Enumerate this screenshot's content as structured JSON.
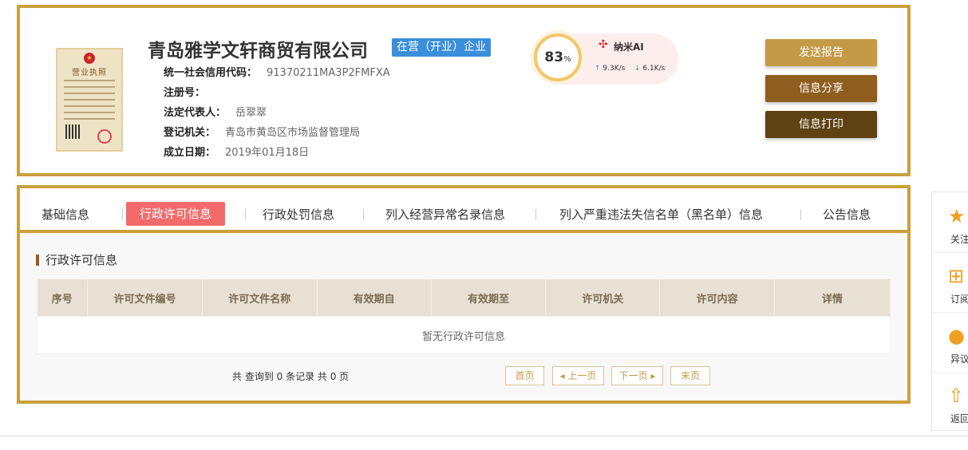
{
  "company": {
    "name": "青岛雅学文轩商贸有限公司",
    "status": "在营（开业）企业",
    "license_thumb": {
      "title": "营业执照",
      "emblem": "★"
    }
  },
  "info": [
    {
      "key": "统一社会信用代码：",
      "value": "91370211MA3P2FMFXA"
    },
    {
      "key": "注册号：",
      "value": ""
    },
    {
      "key": "法定代表人：",
      "value": "岳翠翠"
    },
    {
      "key": "登记机关：",
      "value": "青岛市黄岛区市场监督管理局"
    },
    {
      "key": "成立日期：",
      "value": "2019年01月18日"
    }
  ],
  "score_widget": {
    "score": "83",
    "unit": "%",
    "ai_label": "纳米AI",
    "upload_speed": "9.3K/s",
    "download_speed": "6.1K/s"
  },
  "actions": {
    "report": "发送报告",
    "share": "信息分享",
    "print": "信息打印"
  },
  "tabs": [
    {
      "label": "基础信息"
    },
    {
      "label": "行政许可信息"
    },
    {
      "label": "行政处罚信息"
    },
    {
      "label": "列入经营异常名录信息"
    },
    {
      "label": "列入严重违法失信名单（黑名单）信息"
    },
    {
      "label": "公告信息"
    }
  ],
  "section": {
    "title": "行政许可信息",
    "columns": [
      "序号",
      "许可文件编号",
      "许可文件名称",
      "有效期自",
      "有效期至",
      "许可机关",
      "许可内容",
      "详情"
    ],
    "empty_text": "暂无行政许可信息"
  },
  "pagination": {
    "summary": "共 查询到 0 条记录 共 0 页",
    "first": "首页",
    "prev": "◂ 上一页",
    "next": "下一页 ▸",
    "last": "末页"
  },
  "side_toolbar": [
    {
      "label": "关注",
      "icon": "star-icon"
    },
    {
      "label": "订阅",
      "icon": "plus-box-icon"
    },
    {
      "label": "异议",
      "icon": "chat-bubble-icon"
    },
    {
      "label": "返回",
      "icon": "arrow-up-icon"
    }
  ],
  "colors": {
    "border_gold": "#c9a13c",
    "active_tab": "#f26b6b",
    "status_badge": "#3a8fdb",
    "btn_report": "#c59a47",
    "btn_share": "#8f5e1f",
    "btn_print": "#5e4213"
  }
}
